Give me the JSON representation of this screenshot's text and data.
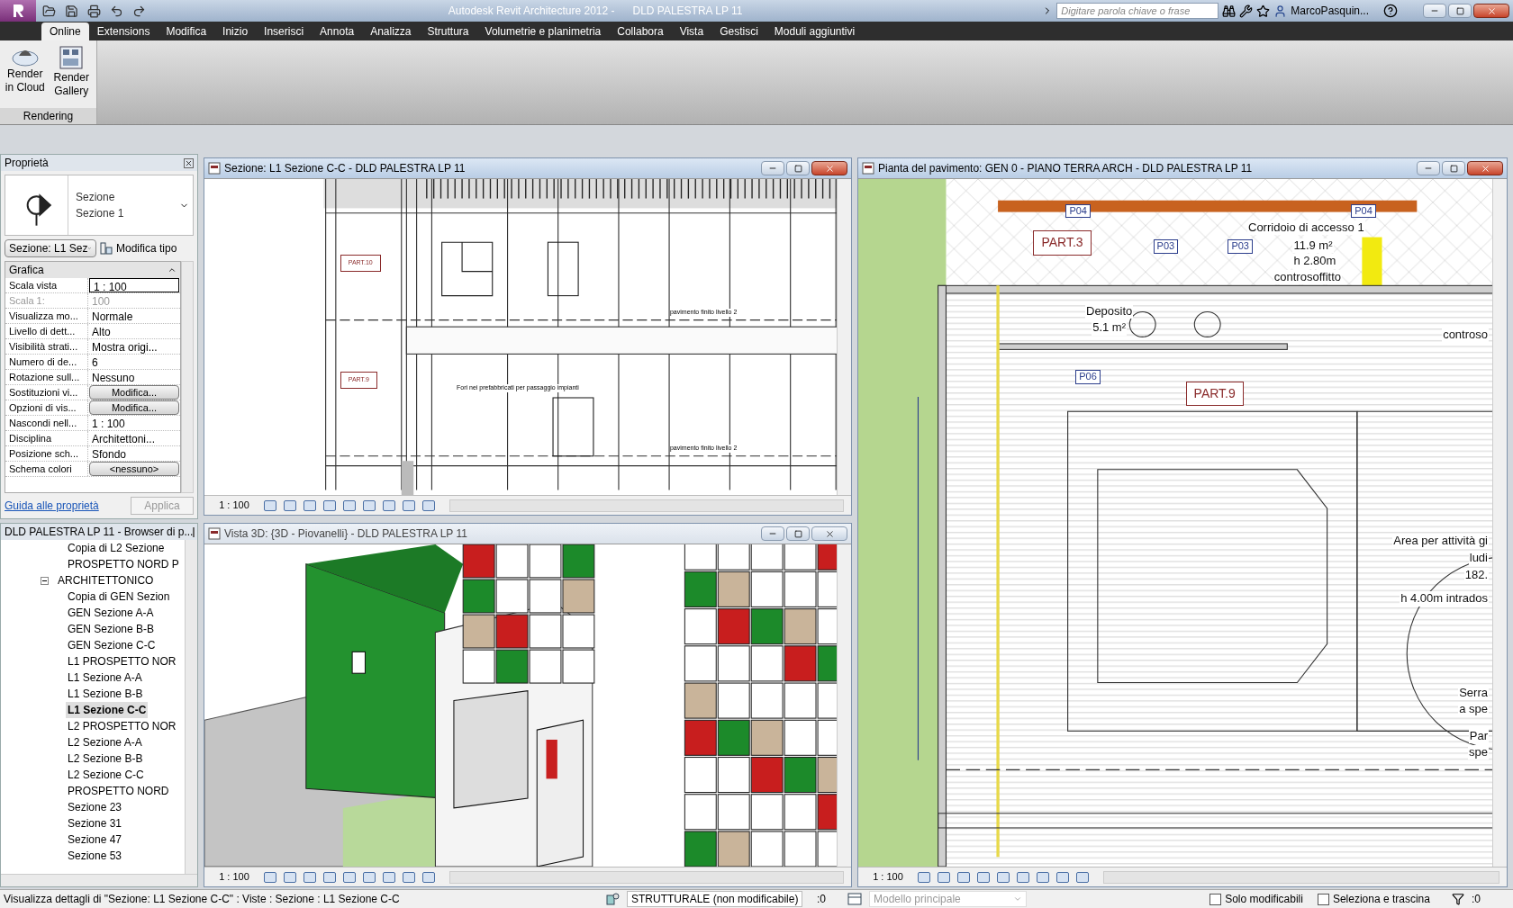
{
  "title_bar": {
    "app": "Autodesk Revit Architecture 2012 -",
    "document": "DLD PALESTRA LP 11",
    "search": {
      "placeholder": "Digitare parola chiave o frase"
    },
    "user": "MarcoPasquin..."
  },
  "ribbon_tabs": [
    {
      "label": "Online",
      "selected": true
    },
    {
      "label": "Extensions",
      "selected": false
    },
    {
      "label": "Modifica",
      "selected": false
    },
    {
      "label": "Inizio",
      "selected": false
    },
    {
      "label": "Inserisci",
      "selected": false
    },
    {
      "label": "Annota",
      "selected": false
    },
    {
      "label": "Analizza",
      "selected": false
    },
    {
      "label": "Struttura",
      "selected": false
    },
    {
      "label": "Volumetrie e planimetria",
      "selected": false
    },
    {
      "label": "Collabora",
      "selected": false
    },
    {
      "label": "Vista",
      "selected": false
    },
    {
      "label": "Gestisci",
      "selected": false
    },
    {
      "label": "Moduli aggiuntivi",
      "selected": false
    }
  ],
  "ribbon": {
    "panel": "Rendering",
    "buttons": [
      {
        "label": "Render in Cloud",
        "kind": "cloud"
      },
      {
        "label": "Render Gallery",
        "kind": "gallery"
      }
    ]
  },
  "properties": {
    "title": "Proprietà",
    "type_line1": "Sezione",
    "type_line2": "Sezione 1",
    "selector": "Sezione: L1 Sez",
    "edit_type": "Modifica tipo",
    "group": "Grafica",
    "rows": [
      {
        "label": "Scala vista",
        "value": "1 : 100",
        "kind": "input"
      },
      {
        "label": "Scala 1:",
        "value": "100",
        "kind": "disabled"
      },
      {
        "label": "Visualizza mo...",
        "value": "Normale",
        "kind": "text"
      },
      {
        "label": "Livello di dett...",
        "value": "Alto",
        "kind": "text"
      },
      {
        "label": "Visibilità strati...",
        "value": "Mostra origi...",
        "kind": "text"
      },
      {
        "label": "Numero di de...",
        "value": "6",
        "kind": "text"
      },
      {
        "label": "Rotazione sull...",
        "value": "Nessuno",
        "kind": "text"
      },
      {
        "label": "Sostituzioni vi...",
        "value": "Modifica...",
        "kind": "button"
      },
      {
        "label": "Opzioni di vis...",
        "value": "Modifica...",
        "kind": "button"
      },
      {
        "label": "Nascondi nell...",
        "value": "1 : 100",
        "kind": "text"
      },
      {
        "label": "Disciplina",
        "value": "Architettoni...",
        "kind": "text"
      },
      {
        "label": "Posizione sch...",
        "value": "Sfondo",
        "kind": "text"
      },
      {
        "label": "Schema colori",
        "value": "<nessuno>",
        "kind": "button"
      }
    ],
    "help_link": "Guida alle proprietà",
    "apply": "Applica"
  },
  "browser": {
    "title": "DLD PALESTRA LP 11 - Browser di p...",
    "tree": [
      {
        "label": "Copia di L2 Sezione",
        "selected": false
      },
      {
        "label": "PROSPETTO NORD P",
        "selected": false
      },
      {
        "label": "ARCHITETTONICO",
        "selected": false,
        "expanded": true,
        "children": [
          {
            "label": "Copia di GEN Sezion",
            "selected": false
          },
          {
            "label": "GEN Sezione A-A",
            "selected": false
          },
          {
            "label": "GEN Sezione B-B",
            "selected": false
          },
          {
            "label": "GEN Sezione C-C",
            "selected": false
          },
          {
            "label": "L1 PROSPETTO NOR",
            "selected": false
          },
          {
            "label": "L1 Sezione A-A",
            "selected": false
          },
          {
            "label": "L1 Sezione B-B",
            "selected": false
          },
          {
            "label": "L1 Sezione C-C",
            "selected": true
          },
          {
            "label": "L2 PROSPETTO NOR",
            "selected": false
          },
          {
            "label": "L2 Sezione A-A",
            "selected": false
          },
          {
            "label": "L2 Sezione B-B",
            "selected": false
          },
          {
            "label": "L2 Sezione C-C",
            "selected": false
          },
          {
            "label": "PROSPETTO NORD",
            "selected": false
          },
          {
            "label": "Sezione 23",
            "selected": false
          },
          {
            "label": "Sezione 31",
            "selected": false
          },
          {
            "label": "Sezione 47",
            "selected": false
          },
          {
            "label": "Sezione 53",
            "selected": false
          }
        ]
      }
    ]
  },
  "views": [
    {
      "kind": "section",
      "title": "Sezione: L1 Sezione C-C - DLD PALESTRA LP 11",
      "active": true,
      "scale": "1 : 100",
      "labels": [
        {
          "text": "PART.10",
          "kind": "part"
        },
        {
          "text": "PART.9",
          "kind": "part"
        },
        {
          "text": "pavimento finito livello 2",
          "kind": "note"
        },
        {
          "text": "Fori nei prefabbricati per passaggio impianti",
          "kind": "note"
        },
        {
          "text": "pavimento finito livello 2",
          "kind": "note"
        }
      ]
    },
    {
      "kind": "model3d",
      "title": "Vista 3D: {3D - Piovanelli} - DLD PALESTRA LP 11",
      "active": false,
      "scale": "1 : 100"
    },
    {
      "kind": "plan",
      "title": "Pianta del pavimento: GEN 0 - PIANO TERRA ARCH - DLD PALESTRA LP 11",
      "active": true,
      "scale": "1 : 100",
      "labels": [
        {
          "text": "P04",
          "kind": "tag"
        },
        {
          "text": "P04",
          "kind": "tag"
        },
        {
          "text": "PART.3",
          "kind": "part"
        },
        {
          "text": "Corridoio di accesso 1",
          "kind": "room"
        },
        {
          "text": "11.9 m²",
          "kind": "room"
        },
        {
          "text": "h 2.80m",
          "kind": "room"
        },
        {
          "text": "controsoffitto",
          "kind": "room"
        },
        {
          "text": "P03",
          "kind": "tag"
        },
        {
          "text": "P03",
          "kind": "tag"
        },
        {
          "text": "Deposito",
          "kind": "room"
        },
        {
          "text": "5.1 m²",
          "kind": "room"
        },
        {
          "text": "P06",
          "kind": "tag"
        },
        {
          "text": "PART.9",
          "kind": "part"
        },
        {
          "text": "controso",
          "kind": "room"
        },
        {
          "text": "Area per attività gi",
          "kind": "room"
        },
        {
          "text": "ludi",
          "kind": "room"
        },
        {
          "text": "182.",
          "kind": "room"
        },
        {
          "text": "h 4.00m intrados",
          "kind": "room"
        },
        {
          "text": "Serra",
          "kind": "room"
        },
        {
          "text": "a spe",
          "kind": "room"
        },
        {
          "text": "Par",
          "kind": "room"
        },
        {
          "text": "spe",
          "kind": "room"
        }
      ]
    }
  ],
  "status_bar": {
    "message": "Visualizza dettagli di \"Sezione: L1 Sezione C-C\" : Viste : Sezione : L1 Sezione C-C",
    "workset": "STRUTTURALE (non modificabile)",
    "count1": ":0",
    "design_option": "Modello principale",
    "checks": [
      {
        "label": "Solo modificabili",
        "checked": false
      },
      {
        "label": "Seleziona e trascina",
        "checked": false
      }
    ],
    "filter_count": ":0"
  }
}
